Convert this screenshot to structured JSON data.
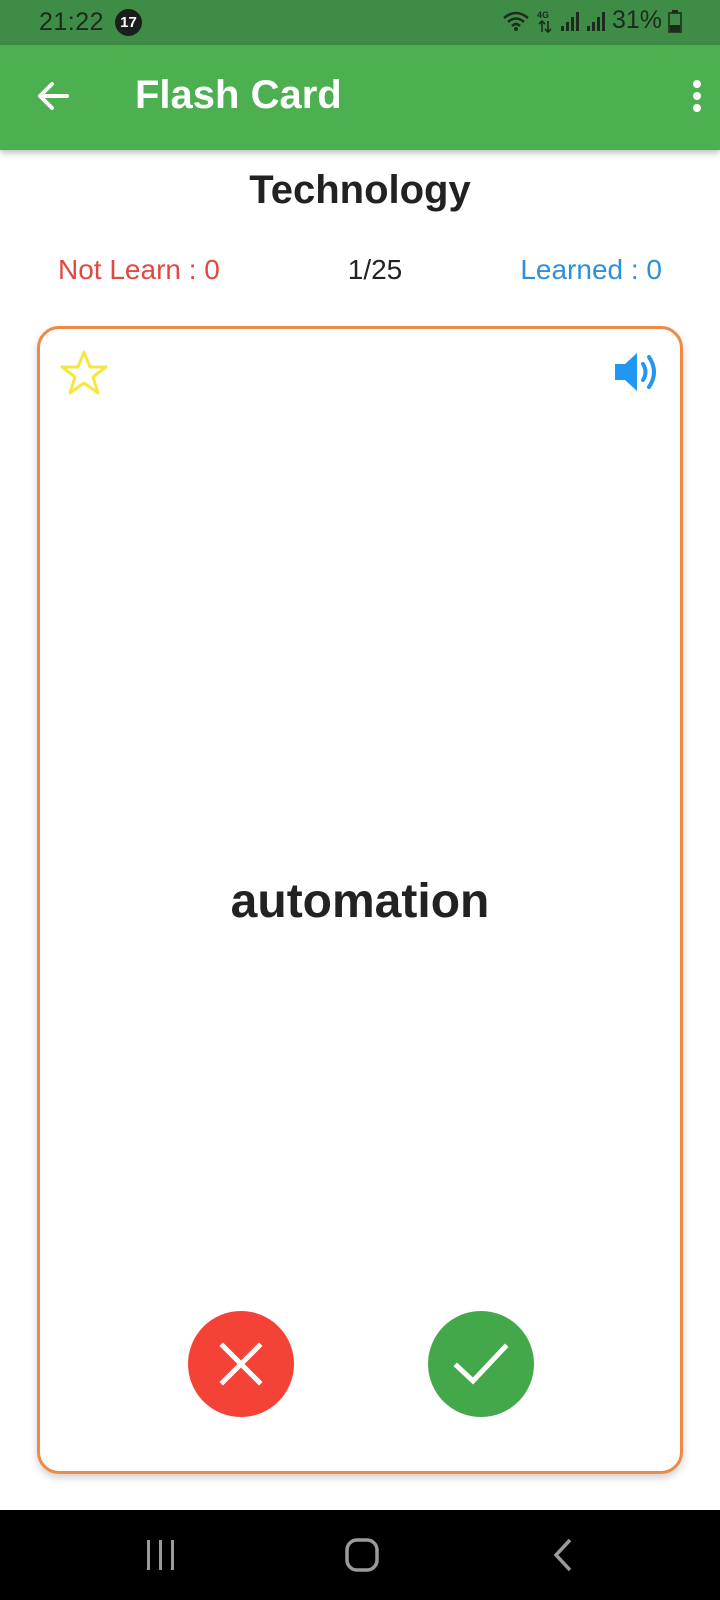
{
  "status_bar": {
    "time": "21:22",
    "notification_count": "17",
    "battery": "31%",
    "icons": [
      "wifi-icon",
      "4g-icon",
      "signal-icon",
      "signal-icon",
      "battery-icon"
    ]
  },
  "app_bar": {
    "title": "Flash Card",
    "back_icon": "arrow-left-icon",
    "menu_icon": "more-vert-icon",
    "color": "#4caf50"
  },
  "deck": {
    "category": "Technology",
    "not_learn_label": "Not Learn :  0",
    "progress": "1/25",
    "learned_label": "Learned : 0",
    "not_learn_color": "#e0493f",
    "learned_color": "#2e8fdb"
  },
  "card": {
    "word": "automation",
    "favorite_icon": "star-outline-icon",
    "sound_icon": "volume-up-icon",
    "border_color": "#ef8a45",
    "wrong_icon": "close-icon",
    "right_icon": "check-icon",
    "wrong_color": "#f44336",
    "right_color": "#43a84a"
  },
  "nav_bar": {
    "recents_icon": "recents-icon",
    "home_icon": "home-icon",
    "back_icon": "back-icon"
  }
}
